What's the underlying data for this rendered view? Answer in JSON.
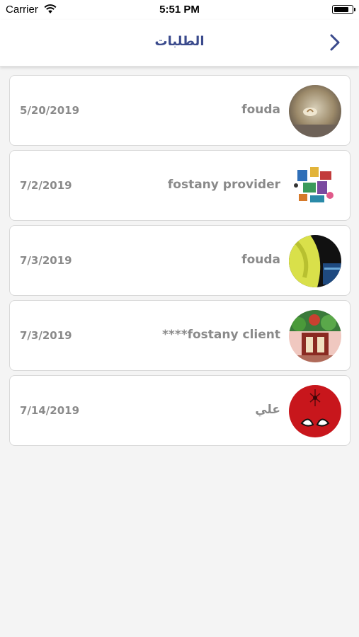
{
  "status_bar": {
    "carrier": "Carrier",
    "time": "5:51 PM"
  },
  "nav": {
    "title": "الطلبات"
  },
  "orders": [
    {
      "name": "fouda",
      "date": "5/20/2019",
      "avatar": "coffee-photo-avatar"
    },
    {
      "name": "fostany provider",
      "date": "7/2/2019",
      "avatar": "collage-photo-avatar"
    },
    {
      "name": "fouda",
      "date": "7/3/2019",
      "avatar": "yellow-abstract-avatar"
    },
    {
      "name": "****fostany client",
      "date": "7/3/2019",
      "avatar": "storefront-photo-avatar"
    },
    {
      "name": "علي",
      "date": "7/14/2019",
      "avatar": "spiderman-avatar"
    }
  ],
  "colors": {
    "title": "#3a4a8c",
    "text_gray": "#8a8a8a",
    "background": "#f4f4f4"
  }
}
